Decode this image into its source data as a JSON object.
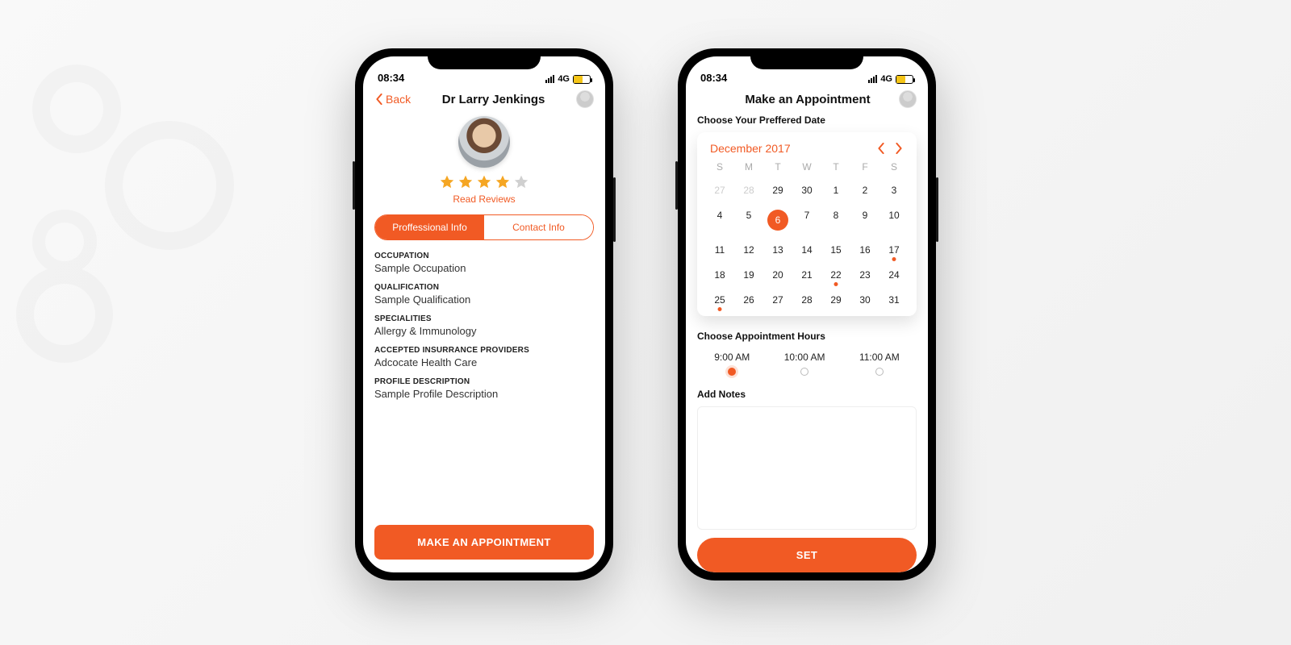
{
  "status": {
    "time": "08:34",
    "net": "4G"
  },
  "accent": "#f15a24",
  "screen1": {
    "back_label": "Back",
    "title": "Dr Larry Jenkings",
    "rating_stars": 4,
    "read_reviews": "Read Reviews",
    "tabs": {
      "pro": "Proffessional Info",
      "contact": "Contact Info"
    },
    "fields": {
      "occupation_lbl": "OCCUPATION",
      "occupation_val": "Sample Occupation",
      "qualification_lbl": "QUALIFICATION",
      "qualification_val": "Sample Qualification",
      "specialities_lbl": "SPECIALITIES",
      "specialities_val": "Allergy & Immunology",
      "insurance_lbl": "ACCEPTED INSURRANCE PROVIDERS",
      "insurance_val": "Adcocate Health Care",
      "profile_lbl": "PROFILE DESCRIPTION",
      "profile_val": "Sample Profile Description"
    },
    "cta": "MAKE AN APPOINTMENT"
  },
  "screen2": {
    "title": "Make an Appointment",
    "choose_date_lbl": "Choose Your Preffered Date",
    "month_label": "December 2017",
    "dow": [
      "S",
      "M",
      "T",
      "W",
      "T",
      "F",
      "S"
    ],
    "weeks": [
      [
        {
          "n": 27,
          "fade": true
        },
        {
          "n": 28,
          "fade": true
        },
        {
          "n": 29
        },
        {
          "n": 30
        },
        {
          "n": 1
        },
        {
          "n": 2
        },
        {
          "n": 3
        }
      ],
      [
        {
          "n": 4
        },
        {
          "n": 5
        },
        {
          "n": 6,
          "sel": true
        },
        {
          "n": 7
        },
        {
          "n": 8
        },
        {
          "n": 9
        },
        {
          "n": 10
        }
      ],
      [
        {
          "n": 11
        },
        {
          "n": 12
        },
        {
          "n": 13
        },
        {
          "n": 14
        },
        {
          "n": 15
        },
        {
          "n": 16
        },
        {
          "n": 17,
          "dot": true
        }
      ],
      [
        {
          "n": 18
        },
        {
          "n": 19
        },
        {
          "n": 20
        },
        {
          "n": 21
        },
        {
          "n": 22,
          "dot": true
        },
        {
          "n": 23
        },
        {
          "n": 24
        }
      ],
      [
        {
          "n": 25,
          "dot": true
        },
        {
          "n": 26
        },
        {
          "n": 27
        },
        {
          "n": 28
        },
        {
          "n": 29
        },
        {
          "n": 30
        },
        {
          "n": 31
        }
      ]
    ],
    "choose_hours_lbl": "Choose Appointment Hours",
    "hours": [
      {
        "label": "9:00 AM",
        "sel": true
      },
      {
        "label": "10:00 AM",
        "sel": false
      },
      {
        "label": "11:00 AM",
        "sel": false
      }
    ],
    "notes_lbl": "Add Notes",
    "cta": "SET"
  }
}
